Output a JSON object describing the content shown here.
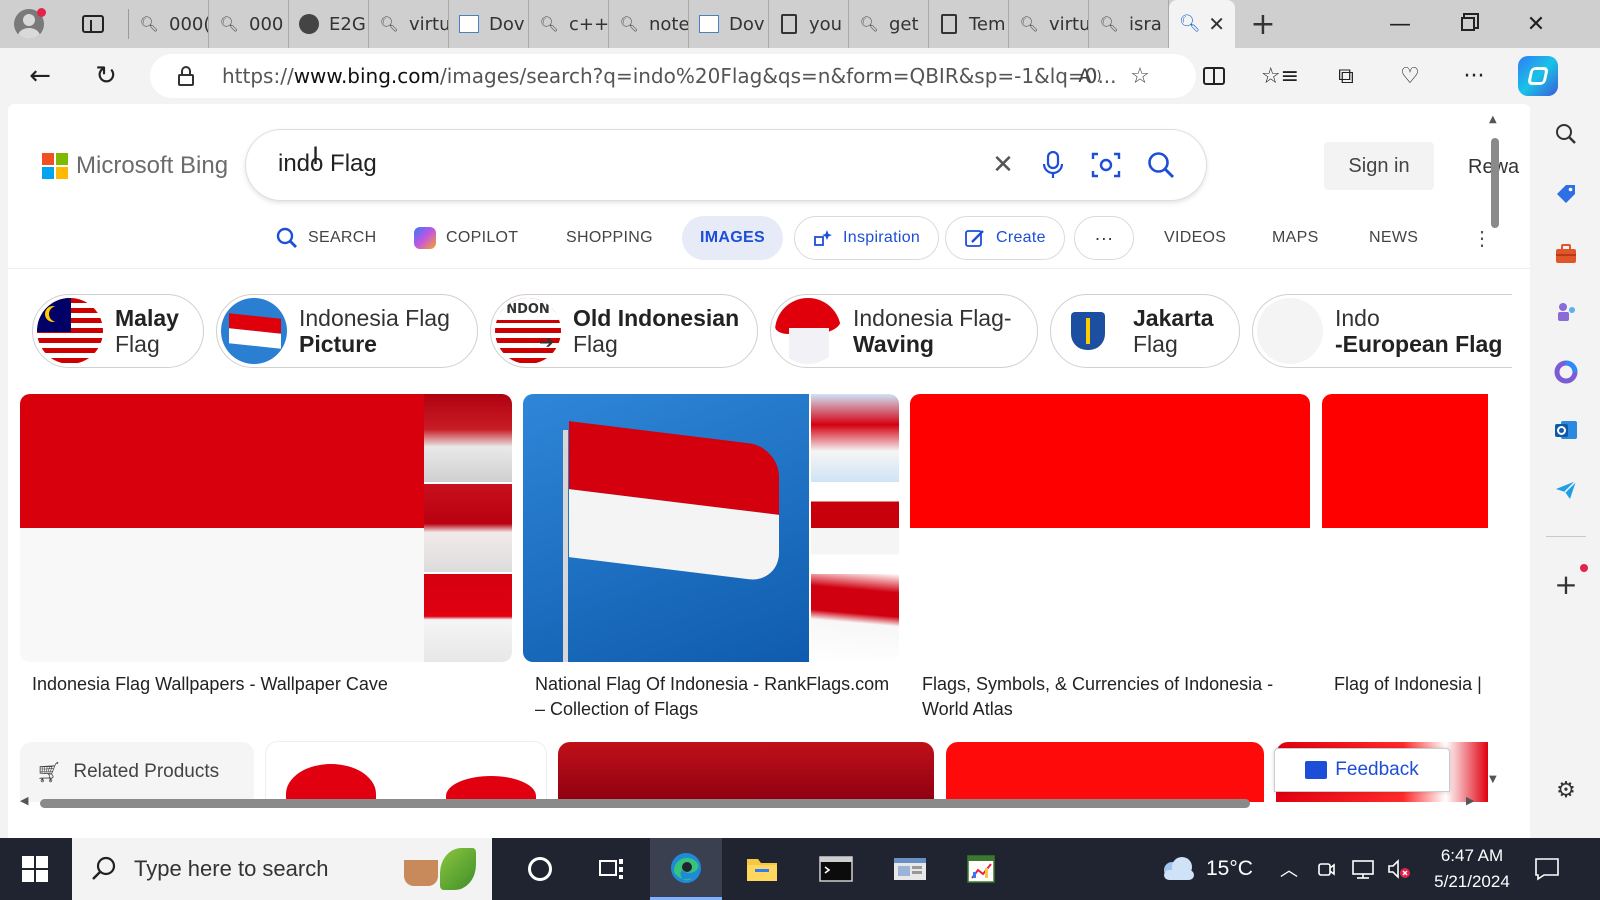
{
  "browser": {
    "tabs": [
      {
        "icon": "search-icon",
        "label": "000("
      },
      {
        "icon": "search-icon",
        "label": "000"
      },
      {
        "icon": "github-icon",
        "label": "E2G"
      },
      {
        "icon": "search-icon",
        "label": "virtu"
      },
      {
        "icon": "chart-icon",
        "label": "Dov"
      },
      {
        "icon": "search-icon",
        "label": "c++"
      },
      {
        "icon": "search-icon",
        "label": "note"
      },
      {
        "icon": "chart-icon",
        "label": "Dov"
      },
      {
        "icon": "page-icon",
        "label": "you"
      },
      {
        "icon": "search-icon",
        "label": "get"
      },
      {
        "icon": "page-icon",
        "label": "Tem"
      },
      {
        "icon": "search-icon",
        "label": "virtu"
      },
      {
        "icon": "search-icon",
        "label": "isra"
      }
    ],
    "url_prefix": "https://",
    "url_host": "www.bing.com",
    "url_rest": "/images/search?q=indo%20Flag&qs=n&form=QBIR&sp=-1&lq=0..."
  },
  "bing": {
    "logo_text": "Microsoft Bing",
    "query": "indo Flag",
    "sign_in": "Sign in",
    "rewards": "Rewa",
    "scopes": {
      "search": "SEARCH",
      "copilot": "COPILOT",
      "shopping": "SHOPPING",
      "images": "IMAGES",
      "inspiration": "Inspiration",
      "create": "Create",
      "more": "···",
      "videos": "VIDEOS",
      "maps": "MAPS",
      "news": "NEWS"
    },
    "related": [
      {
        "bold": "Malay",
        "normal": "Flag",
        "bold_first": true
      },
      {
        "normal": "Indonesia Flag",
        "bold": "Picture",
        "bold_first": false
      },
      {
        "bold": "Old Indonesian",
        "normal": "Flag",
        "bold_first": true
      },
      {
        "normal": "Indonesia Flag-",
        "bold": "Waving",
        "bold_first": false
      },
      {
        "bold": "Jakarta",
        "normal": "Flag",
        "bold_first": true
      },
      {
        "normal": "Indo",
        "bold": "-European Flag",
        "bold_first": false
      }
    ],
    "results": [
      {
        "caption": "Indonesia Flag Wallpapers - Wallpaper Cave"
      },
      {
        "caption": "National Flag Of Indonesia - RankFlags.com – Collection of Flags"
      },
      {
        "caption": "Flags, Symbols, & Currencies of Indonesia - World Atlas"
      },
      {
        "caption": "Flag of Indonesia |"
      }
    ],
    "related_products": "Related Products",
    "feedback": "Feedback"
  },
  "taskbar": {
    "search_placeholder": "Type here to search",
    "temperature": "15°C",
    "time": "6:47 AM",
    "date": "5/21/2024"
  },
  "colors": {
    "flag_red": "#ff0000",
    "bing_blue": "#1d4ed8",
    "taskbar_bg": "#1f2430"
  }
}
